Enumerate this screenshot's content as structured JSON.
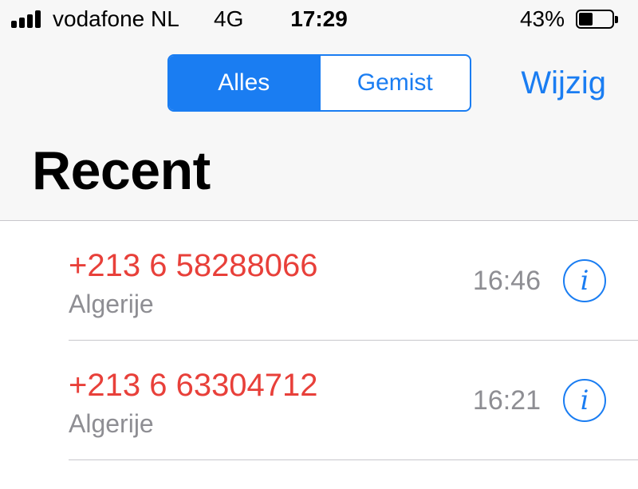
{
  "status_bar": {
    "carrier": "vodafone NL",
    "network": "4G",
    "time": "17:29",
    "battery_percent": "43%",
    "battery_level": 0.43,
    "signal_bars": 4
  },
  "segmented_control": {
    "options": [
      {
        "label": "Alles",
        "selected": true
      },
      {
        "label": "Gemist",
        "selected": false
      }
    ]
  },
  "edit_label": "Wijzig",
  "title": "Recent",
  "calls": [
    {
      "number": "+213 6 58288066",
      "location": "Algerije",
      "time": "16:46",
      "info_icon": "info-icon"
    },
    {
      "number": "+213 6 63304712",
      "location": "Algerije",
      "time": "16:21",
      "info_icon": "info-icon"
    }
  ],
  "colors": {
    "accent": "#1a7df2",
    "missed_call": "#e8403a",
    "secondary_text": "#8e8e93"
  }
}
